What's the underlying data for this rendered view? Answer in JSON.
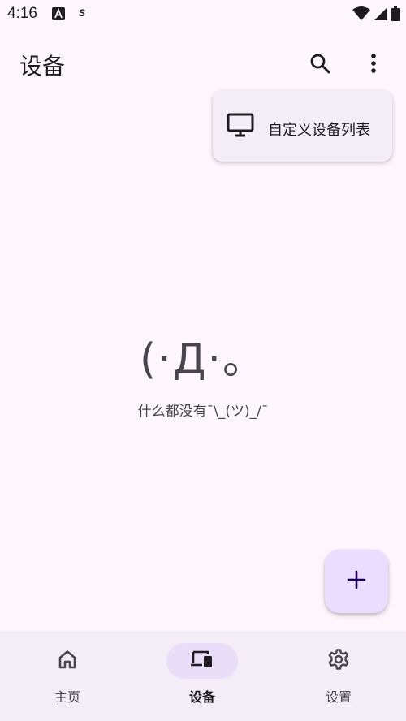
{
  "status_bar": {
    "time": "4:16",
    "icons": [
      "a-badge-icon",
      "s-icon",
      "wifi-icon",
      "signal-icon",
      "battery-icon"
    ],
    "s_glyph": "S"
  },
  "app_bar": {
    "title": "设备",
    "actions": [
      "search-icon",
      "more-vert-icon"
    ]
  },
  "menu": {
    "items": [
      {
        "icon": "monitor-icon",
        "label": "自定义设备列表"
      }
    ]
  },
  "empty_state": {
    "face": "(·Д·。",
    "text": "什么都没有¯\\_(ツ)_/¯"
  },
  "fab": {
    "icon": "plus-icon"
  },
  "bottom_nav": {
    "items": [
      {
        "icon": "home-icon",
        "label": "主页",
        "active": false
      },
      {
        "icon": "devices-icon",
        "label": "设备",
        "active": true
      },
      {
        "icon": "settings-gear-icon",
        "label": "设置",
        "active": false
      }
    ]
  },
  "colors": {
    "background": "#fdf7fd",
    "surface_container": "#f3edf7",
    "fab_container": "#eaddff",
    "active_indicator": "#e8def8",
    "on_surface": "#1d1b20",
    "on_surface_variant": "#49454f"
  }
}
